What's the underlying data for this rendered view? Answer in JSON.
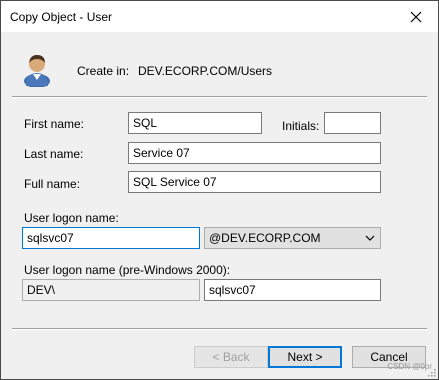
{
  "window": {
    "title": "Copy Object - User"
  },
  "icons": {
    "user": "user-icon",
    "close": "close-icon",
    "chevron": "chevron-down-icon"
  },
  "header": {
    "create_in_label": "Create in:",
    "create_in_value": "DEV.ECORP.COM/Users"
  },
  "form": {
    "first_name_label": "First name:",
    "first_name_value": "SQL",
    "initials_label": "Initials:",
    "initials_value": "",
    "last_name_label": "Last name:",
    "last_name_value": "Service 07",
    "full_name_label": "Full name:",
    "full_name_value": "SQL Service 07",
    "logon_label": "User logon name:",
    "logon_value": "sqlsvc07",
    "domain_selected": "@DEV.ECORP.COM",
    "pre2000_label": "User logon name (pre-Windows 2000):",
    "pre2000_domain": "DEV\\",
    "pre2000_value": "sqlsvc07"
  },
  "buttons": {
    "back": "< Back",
    "next": "Next >",
    "cancel": "Cancel"
  },
  "watermark": "CSDN @0pr"
}
